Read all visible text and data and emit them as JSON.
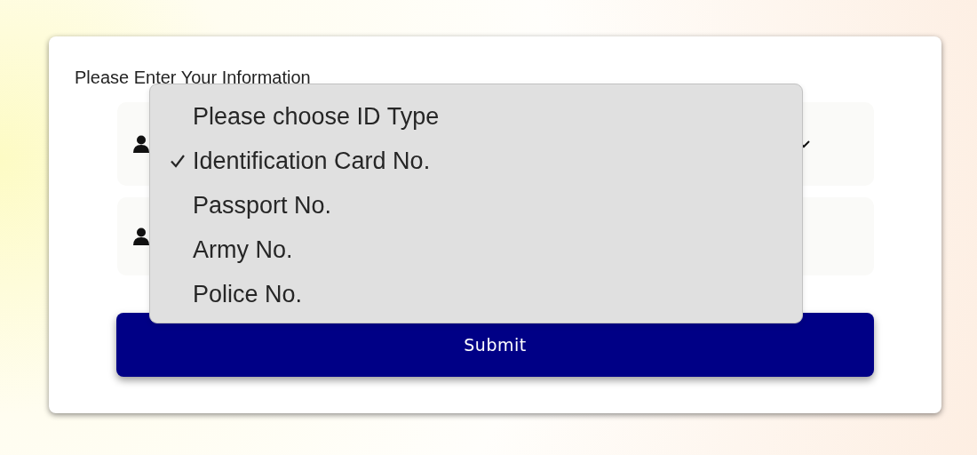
{
  "form": {
    "title": "Please Enter Your Information",
    "fields": [
      {
        "kind": "select"
      },
      {
        "kind": "text"
      }
    ],
    "dropdown": {
      "options": [
        {
          "label": "Please choose ID Type",
          "selected": false
        },
        {
          "label": "Identification Card No.",
          "selected": true
        },
        {
          "label": "Passport No.",
          "selected": false
        },
        {
          "label": "Army No.",
          "selected": false
        },
        {
          "label": "Police No.",
          "selected": false
        }
      ]
    },
    "submit": {
      "label": "Submit"
    }
  }
}
